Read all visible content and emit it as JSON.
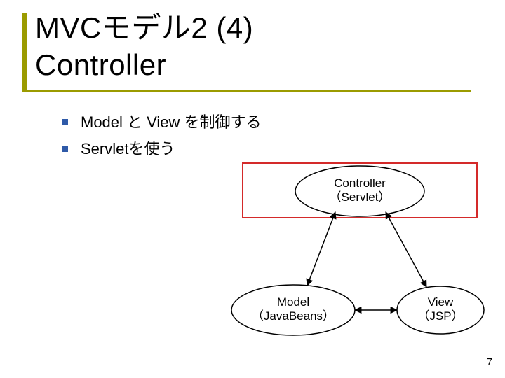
{
  "title_line1": "MVCモデル2 (4)",
  "title_line2": "Controller",
  "bullets": [
    "Model と View を制御する",
    "Servletを使う"
  ],
  "diagram": {
    "controller": {
      "line1": "Controller",
      "line2": "（Servlet）"
    },
    "model": {
      "line1": "Model",
      "line2": "（JavaBeans）"
    },
    "view": {
      "line1": "View",
      "line2": "（JSP）"
    }
  },
  "page_number": "7"
}
